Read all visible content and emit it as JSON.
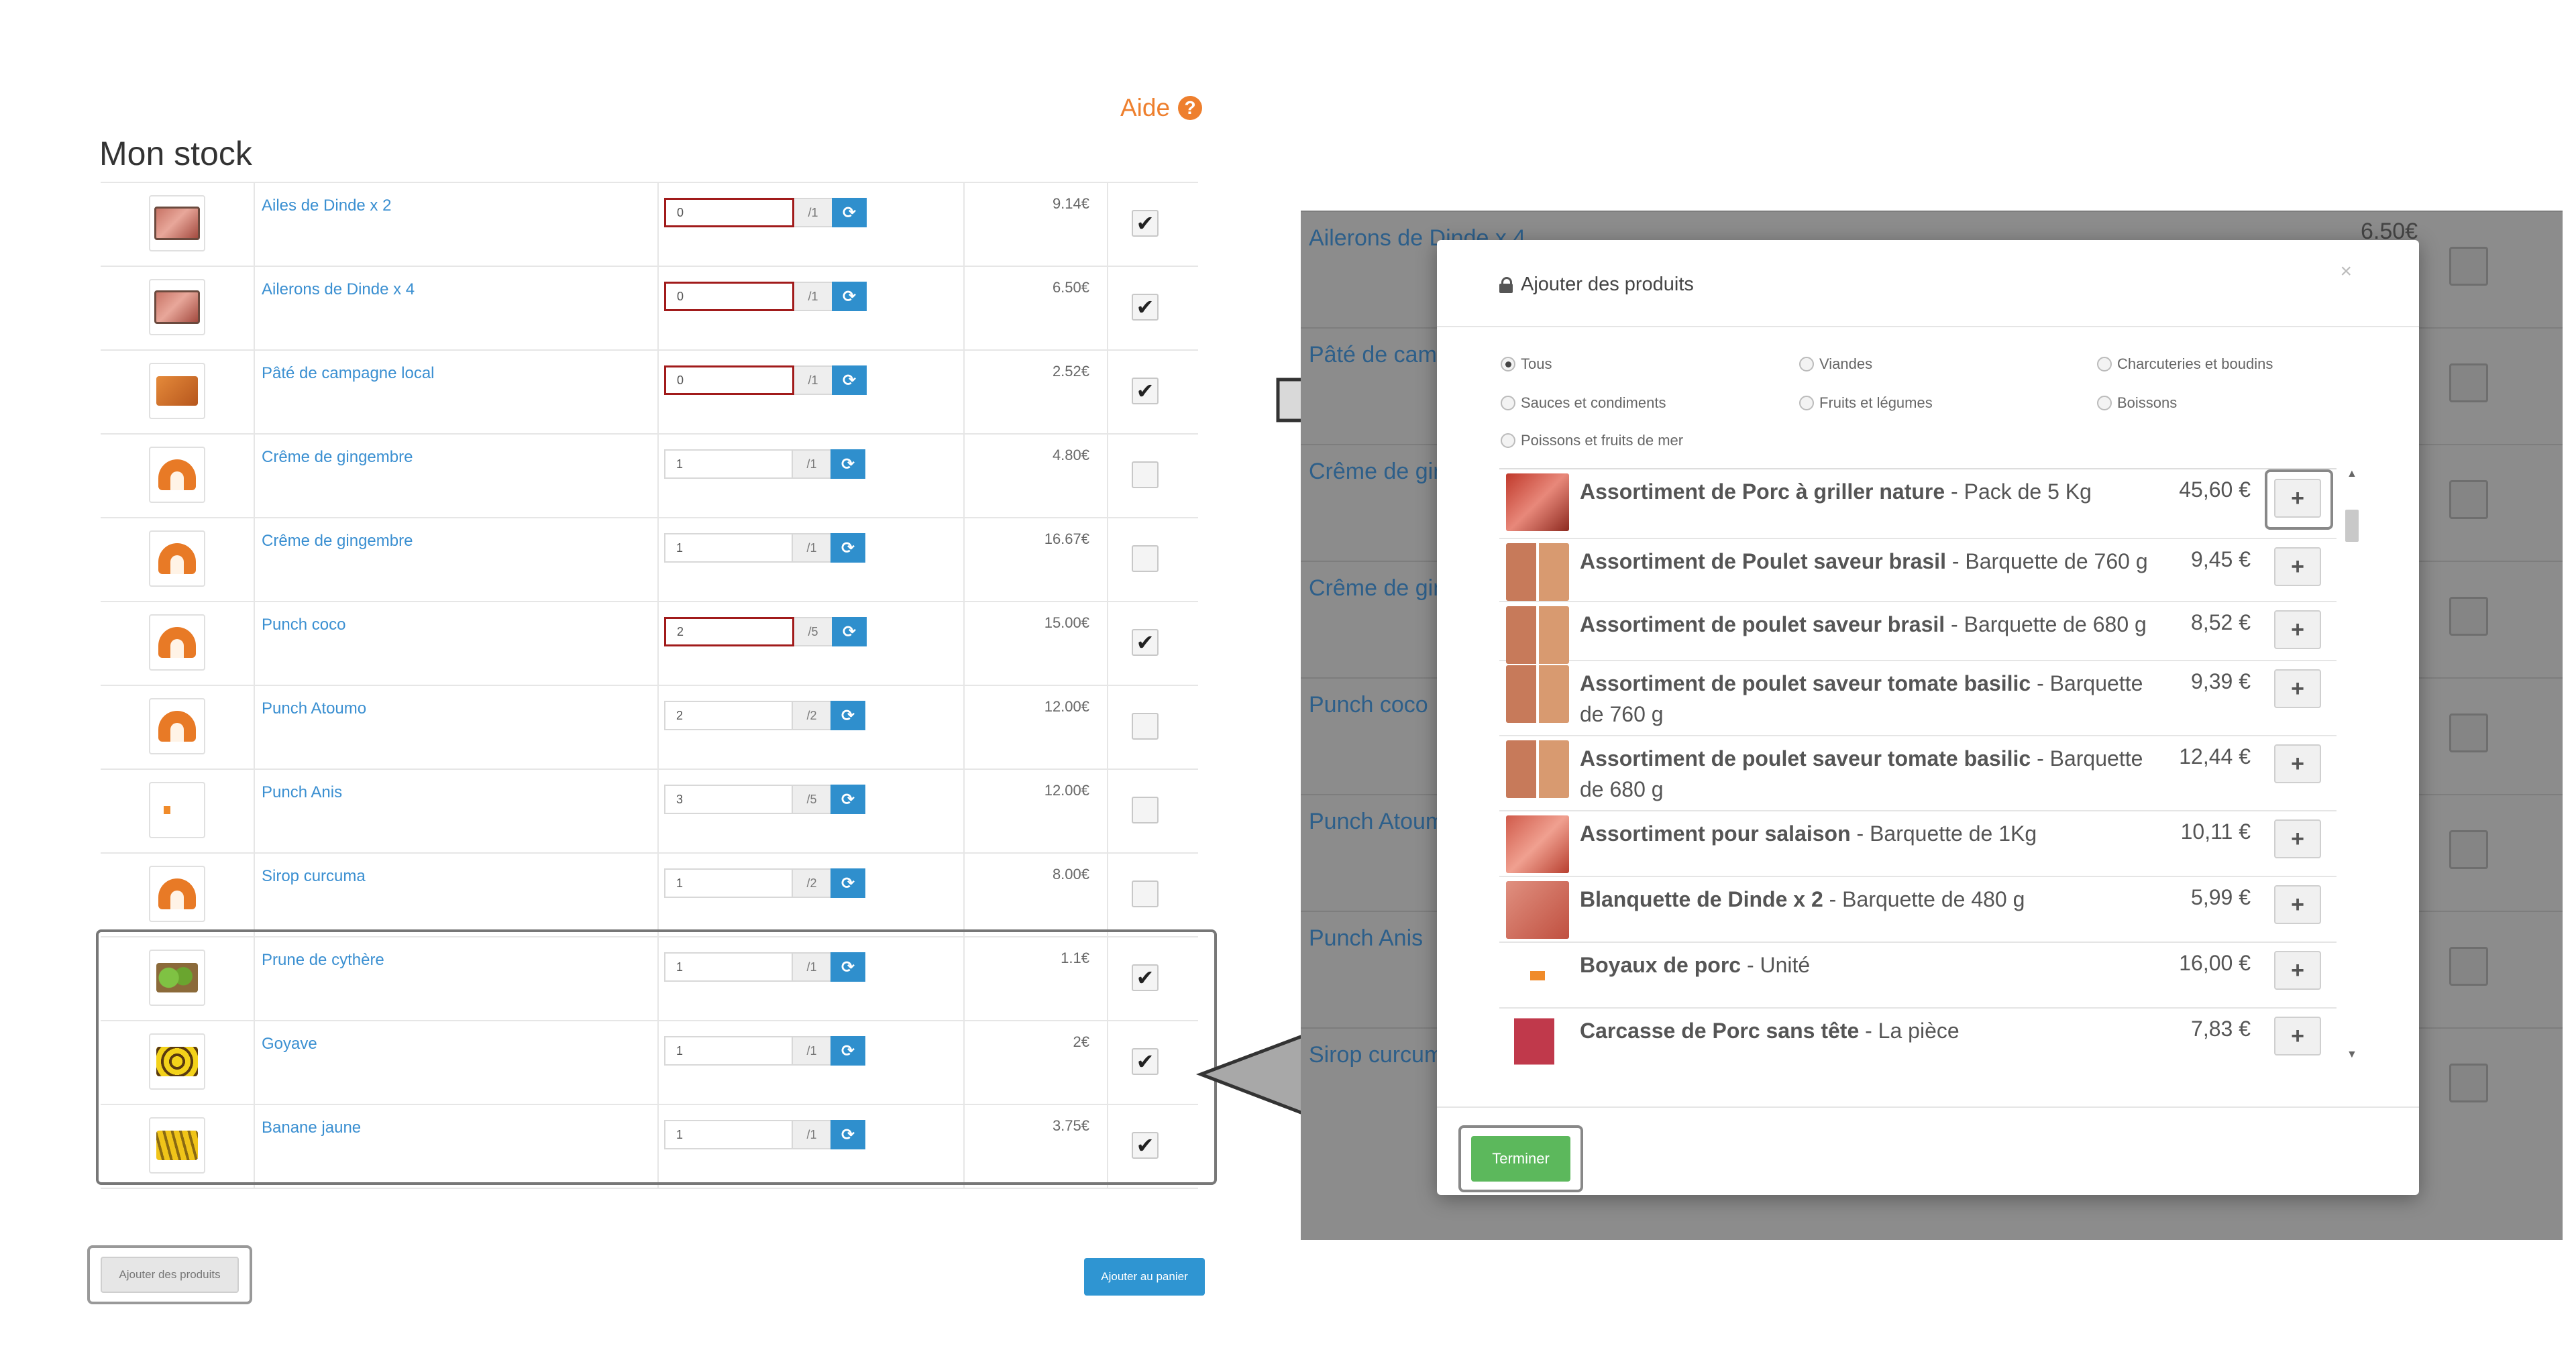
{
  "header": {
    "help_label": "Aide",
    "help_icon": "question-circle-icon",
    "title": "Mon stock"
  },
  "stock_rows": [
    {
      "name": "Ailes de Dinde x 2",
      "qty": "0",
      "max": "/1",
      "price": "9.14€",
      "checked": true,
      "qty_error": true,
      "img": "meat"
    },
    {
      "name": "Ailerons de Dinde x 4",
      "qty": "0",
      "max": "/1",
      "price": "6.50€",
      "checked": true,
      "qty_error": true,
      "img": "meat"
    },
    {
      "name": "Pâté de campagne local",
      "qty": "0",
      "max": "/1",
      "price": "2.52€",
      "checked": true,
      "qty_error": true,
      "img": "pate"
    },
    {
      "name": "Crême de gingembre",
      "qty": "1",
      "max": "/1",
      "price": "4.80€",
      "checked": false,
      "qty_error": false,
      "img": "dome"
    },
    {
      "name": "Crême de gingembre",
      "qty": "1",
      "max": "/1",
      "price": "16.67€",
      "checked": false,
      "qty_error": false,
      "img": "dome"
    },
    {
      "name": "Punch coco",
      "qty": "2",
      "max": "/5",
      "price": "15.00€",
      "checked": true,
      "qty_error": true,
      "img": "dome"
    },
    {
      "name": "Punch Atoumo",
      "qty": "2",
      "max": "/2",
      "price": "12.00€",
      "checked": false,
      "qty_error": false,
      "img": "dome"
    },
    {
      "name": "Punch Anis",
      "qty": "3",
      "max": "/5",
      "price": "12.00€",
      "checked": false,
      "qty_error": false,
      "img": "tiny"
    },
    {
      "name": "Sirop curcuma",
      "qty": "1",
      "max": "/2",
      "price": "8.00€",
      "checked": false,
      "qty_error": false,
      "img": "dome"
    },
    {
      "name": "Prune de cythère",
      "qty": "1",
      "max": "/1",
      "price": "1.1€",
      "checked": true,
      "qty_error": false,
      "img": "green"
    },
    {
      "name": "Goyave",
      "qty": "1",
      "max": "/1",
      "price": "2€",
      "checked": true,
      "qty_error": false,
      "img": "guava"
    },
    {
      "name": "Banane jaune",
      "qty": "1",
      "max": "/1",
      "price": "3.75€",
      "checked": true,
      "qty_error": false,
      "img": "banana"
    }
  ],
  "buttons": {
    "add_products": "Ajouter des produits",
    "add_to_cart": "Ajouter au panier"
  },
  "background_rows": [
    {
      "name": "Ailerons de Dinde x 4",
      "price": "6.50€"
    },
    {
      "name": "Pâté de campagne local"
    },
    {
      "name": "Crême de gingembre"
    },
    {
      "name": "Crême de gingembre"
    },
    {
      "name": "Punch coco"
    },
    {
      "name": "Punch Atoumo"
    },
    {
      "name": "Punch Anis"
    },
    {
      "name": "Sirop curcuma"
    }
  ],
  "modal": {
    "title": "Ajouter des produits",
    "close": "×",
    "filters": [
      {
        "label": "Tous",
        "selected": true
      },
      {
        "label": "Viandes",
        "selected": false
      },
      {
        "label": "Charcuteries et boudins",
        "selected": false
      },
      {
        "label": "Sauces et condiments",
        "selected": false
      },
      {
        "label": "Fruits et légumes",
        "selected": false
      },
      {
        "label": "Boissons",
        "selected": false
      },
      {
        "label": "Poissons et fruits de mer",
        "selected": false
      }
    ],
    "products": [
      {
        "name": "Assortiment de Porc à  griller nature",
        "detail": " - Pack de 5 Kg",
        "price": "45,60 €",
        "img": "pork"
      },
      {
        "name": "Assortiment de Poulet saveur brasil",
        "detail": " - Barquette de 760 g",
        "price": "9,45 €",
        "img": "chicken"
      },
      {
        "name": "Assortiment de poulet saveur brasil",
        "detail": " - Barquette de 680 g",
        "price": "8,52 €",
        "img": "chicken"
      },
      {
        "name": "Assortiment de poulet saveur tomate basilic",
        "detail": " - Barquette de 760 g",
        "price": "9,39 €",
        "img": "chicken"
      },
      {
        "name": "Assortiment de poulet saveur tomate basilic",
        "detail": " - Barquette de 680 g",
        "price": "12,44 €",
        "img": "chicken"
      },
      {
        "name": "Assortiment pour salaison",
        "detail": " - Barquette de 1Kg",
        "price": "10,11 €",
        "img": "salaison"
      },
      {
        "name": "Blanquette de Dinde x 2",
        "detail": " - Barquette de 480 g",
        "price": "5,99 €",
        "img": "dinde"
      },
      {
        "name": "Boyaux de porc",
        "detail": " - Unité",
        "price": "16,00 €",
        "img": "boyaux"
      },
      {
        "name": "Carcasse de Porc sans tête",
        "detail": " - La pièce",
        "price": "7,83 €",
        "img": "carcasse"
      }
    ],
    "plus_label": "+",
    "done_label": "Terminer"
  },
  "colors": {
    "accent_orange": "#ee7f2d",
    "link_blue": "#3a8fd1",
    "button_blue": "#2f8fcd",
    "success_green": "#5cb85c",
    "error_red": "#a11b1b"
  }
}
